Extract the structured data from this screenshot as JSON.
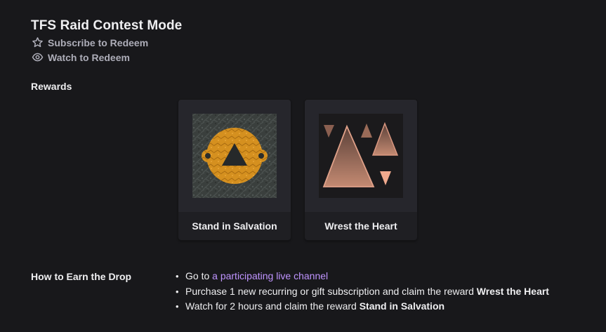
{
  "campaign": {
    "title": "TFS Raid Contest Mode",
    "subscribe_label": "Subscribe to Redeem",
    "watch_label": "Watch to Redeem"
  },
  "rewards": {
    "label": "Rewards",
    "items": [
      {
        "name": "Stand in Salvation",
        "icon": "salvation-emblem"
      },
      {
        "name": "Wrest the Heart",
        "icon": "triangles-emblem"
      }
    ]
  },
  "earn": {
    "label": "How to Earn the Drop",
    "step1_prefix": "Go to ",
    "step1_link": "a participating live channel",
    "step2_prefix": "Purchase 1 new recurring or gift subscription and claim the reward ",
    "step2_reward": "Wrest the Heart",
    "step3_prefix": "Watch for 2 hours and claim the reward ",
    "step3_reward": "Stand in Salvation",
    "bullet": "•"
  },
  "colors": {
    "background": "#18181b",
    "card": "#1f1f23",
    "link": "#bf94ff",
    "muted": "#adadb8"
  }
}
